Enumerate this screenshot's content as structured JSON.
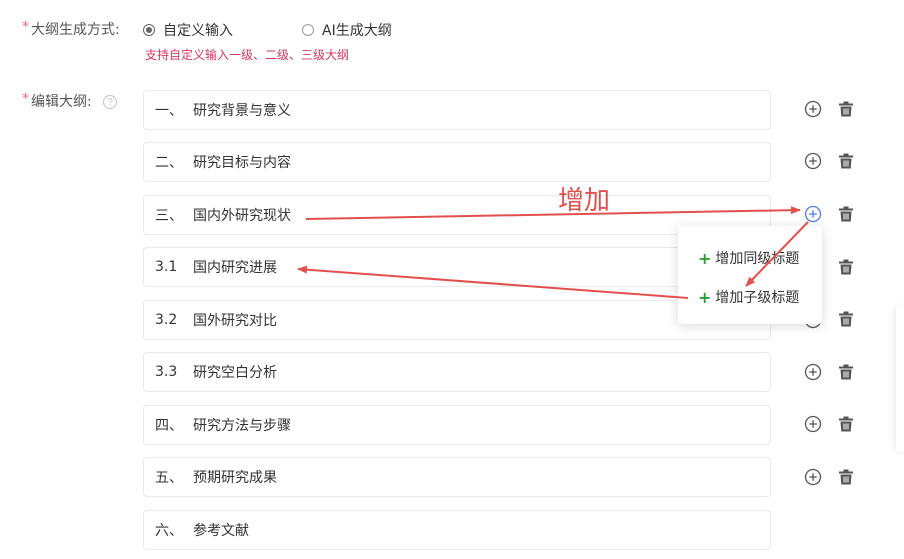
{
  "form": {
    "generation_mode": {
      "required_mark": "*",
      "label": "大纲生成方式:",
      "options": [
        {
          "label": "自定义输入",
          "checked": true
        },
        {
          "label": "AI生成大纲",
          "checked": false
        }
      ],
      "hint": "支持自定义输入一级、二级、三级大纲"
    },
    "edit_outline": {
      "required_mark": "*",
      "label": "编辑大纲:",
      "help_glyph": "?"
    }
  },
  "outline": [
    {
      "num": "一、",
      "title": "研究背景与意义"
    },
    {
      "num": "二、",
      "title": "研究目标与内容"
    },
    {
      "num": "三、",
      "title": "国内外研究现状"
    },
    {
      "num": "3.1",
      "title": "国内研究进展"
    },
    {
      "num": "3.2",
      "title": "国外研究对比"
    },
    {
      "num": "3.3",
      "title": "研究空白分析"
    },
    {
      "num": "四、",
      "title": "研究方法与步骤"
    },
    {
      "num": "五、",
      "title": "预期研究成果"
    },
    {
      "num": "六、",
      "title": "参考文献"
    }
  ],
  "add_menu": {
    "items": [
      {
        "icon": "+",
        "label": "增加同级标题"
      },
      {
        "icon": "+",
        "label": "增加子级标题"
      }
    ]
  },
  "annotation": {
    "text": "增加",
    "color": "#e2504e"
  },
  "colors": {
    "required": "#f56c6c",
    "hint": "#d9365b",
    "active_icon": "#4a7cf0",
    "menu_plus": "#2e9b35"
  },
  "icons": {
    "add": "plus-circle-icon",
    "delete": "trash-icon",
    "help": "question-circle-icon"
  }
}
